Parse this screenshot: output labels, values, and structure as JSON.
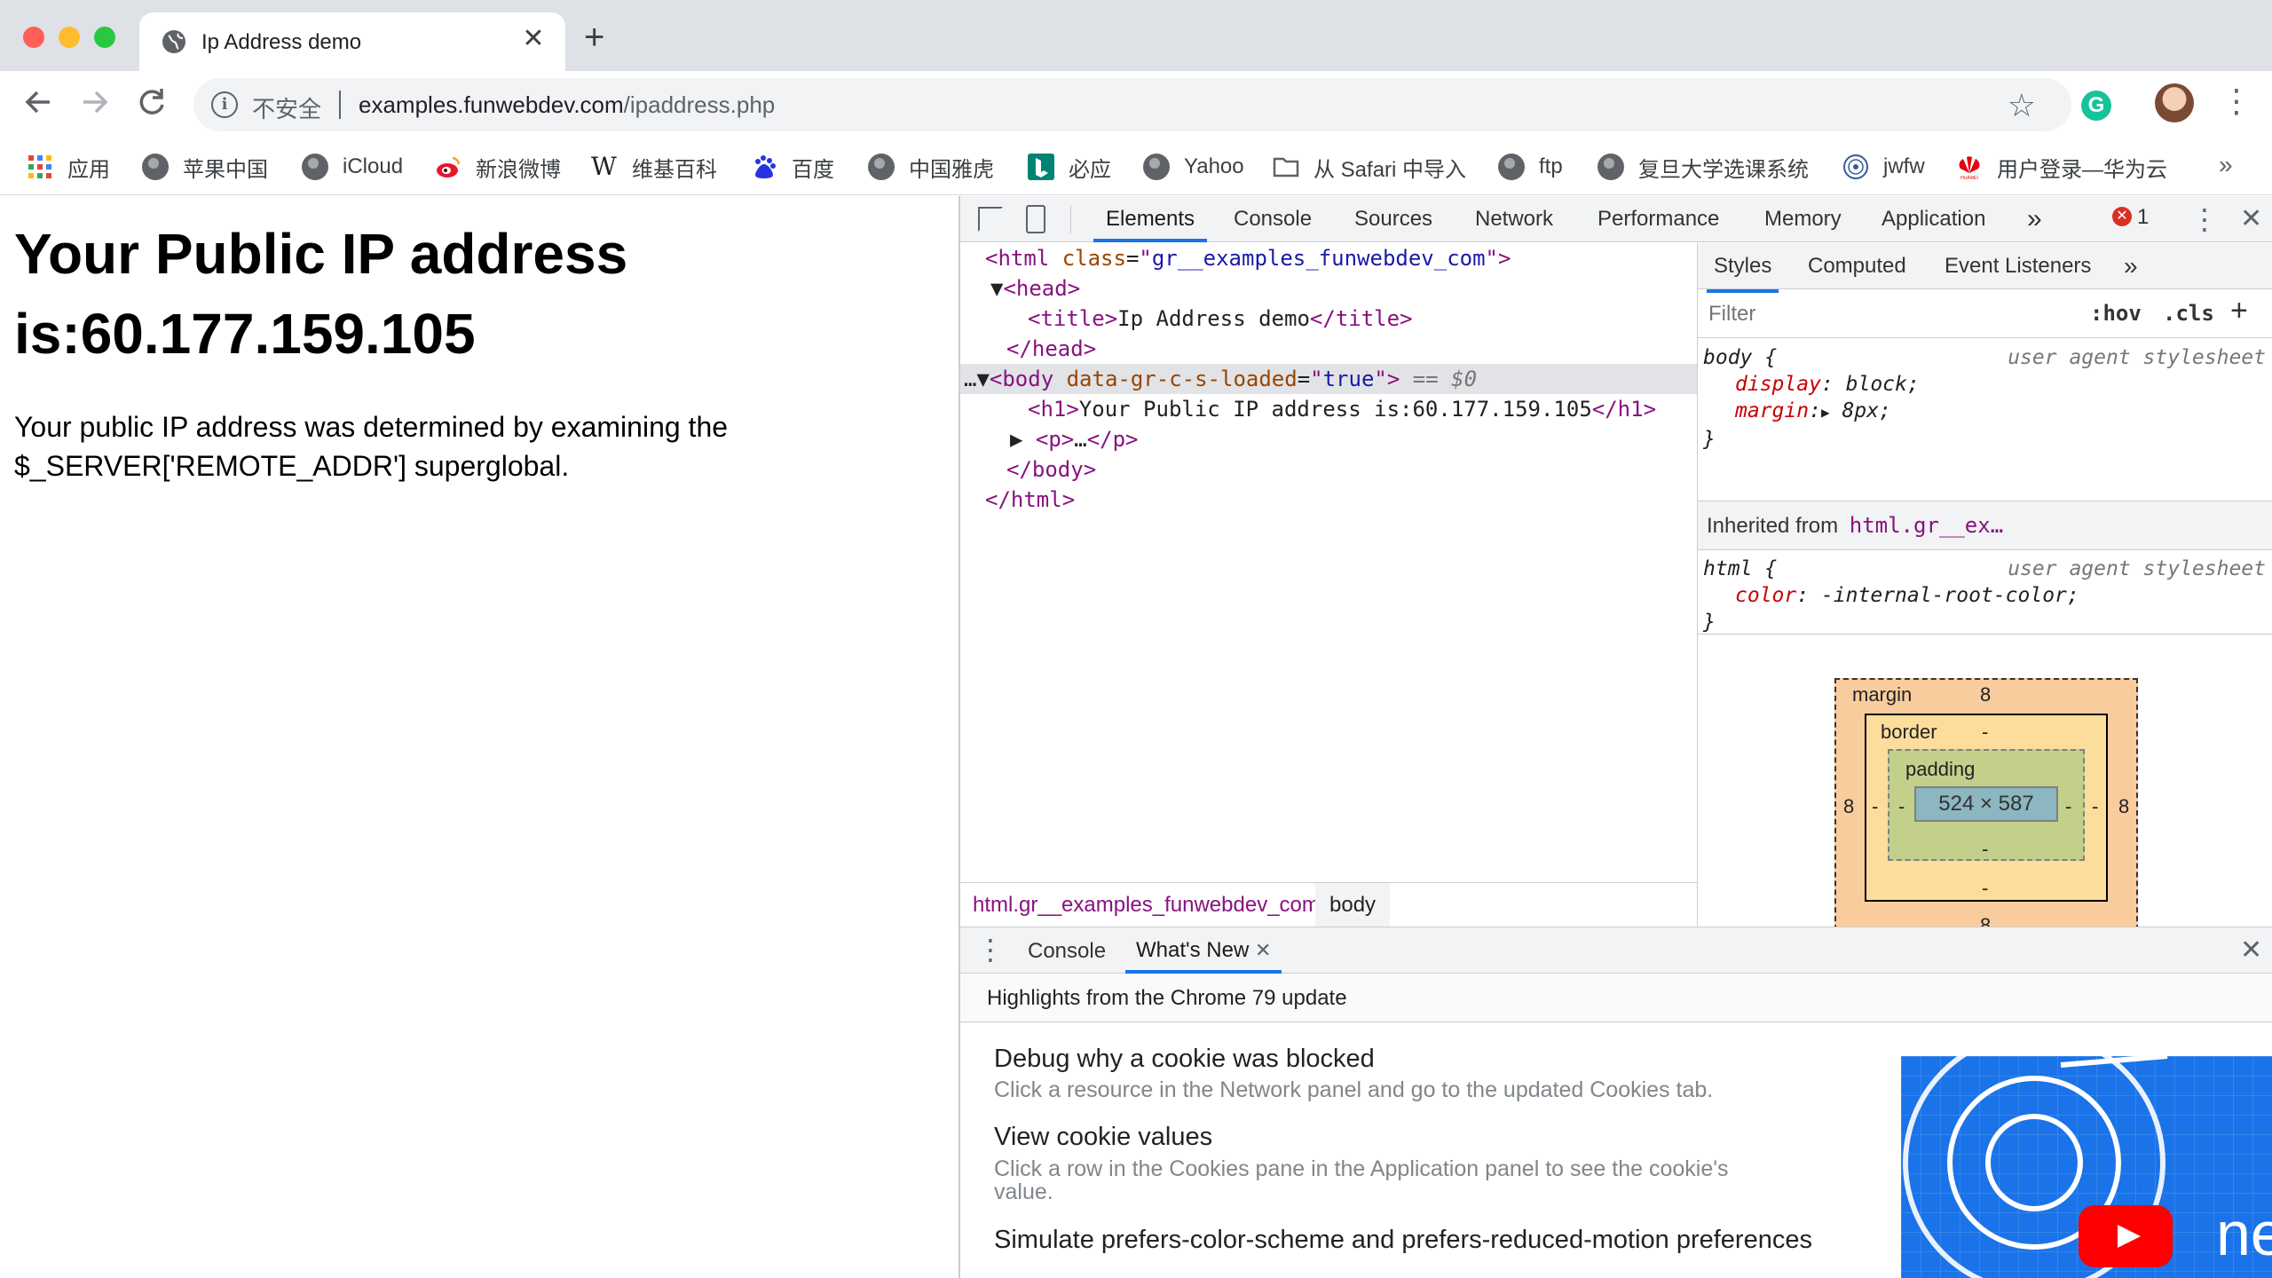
{
  "colors": {
    "tab_strip": "#dee1e6",
    "accent_blue": "#1a73e8",
    "error_red": "#d93025",
    "close_red": "#ff5f57",
    "minimize_yellow": "#febc2e",
    "zoom_green": "#28c840"
  },
  "browser": {
    "tab_title": "Ip Address demo",
    "tab_icon": "globe-icon",
    "new_tab": "+",
    "security_label": "不安全",
    "url_host": "examples.funwebdev.com",
    "url_path": "/ipaddress.php",
    "extension_letter": "G"
  },
  "bookmarks": [
    {
      "label": "应用",
      "icon": "apps-grid-icon"
    },
    {
      "label": "苹果中国",
      "icon": "globe-icon"
    },
    {
      "label": "iCloud",
      "icon": "globe-icon"
    },
    {
      "label": "新浪微博",
      "icon": "weibo-icon"
    },
    {
      "label": "维基百科",
      "icon": "wikipedia-icon"
    },
    {
      "label": "百度",
      "icon": "baidu-icon"
    },
    {
      "label": "中国雅虎",
      "icon": "globe-icon"
    },
    {
      "label": "必应",
      "icon": "bing-icon"
    },
    {
      "label": "Yahoo",
      "icon": "globe-icon"
    },
    {
      "label": "从 Safari 中导入",
      "icon": "folder-icon"
    },
    {
      "label": "ftp",
      "icon": "globe-icon"
    },
    {
      "label": "复旦大学选课系统",
      "icon": "globe-icon"
    },
    {
      "label": "jwfw",
      "icon": "fudan-seal-icon"
    },
    {
      "label": "用户登录—华为云",
      "icon": "huawei-icon"
    }
  ],
  "page": {
    "heading": "Your Public IP address is:60.177.159.105",
    "paragraph": "Your public IP address was determined by examining the $_SERVER['REMOTE_ADDR'] superglobal."
  },
  "devtools": {
    "tabs": [
      "Elements",
      "Console",
      "Sources",
      "Network",
      "Performance",
      "Memory",
      "Application"
    ],
    "active_tab": "Elements",
    "more_tabs": "»",
    "error_count": "1",
    "dom": {
      "html_open_tag": "html",
      "html_class_attr": "class",
      "html_class_value": "gr__examples_funwebdev_com",
      "head": "head",
      "title_tag": "title",
      "title_text": "Ip Address demo",
      "body_attr": "data-gr-c-s-loaded",
      "body_attr_value": "true",
      "dollar_zero": "== $0",
      "h1_text": "Your Public IP address is:60.177.159.105",
      "p_ellipsis": "…"
    },
    "breadcrumbs": [
      "html.gr__examples_funwebdev_com",
      "body"
    ],
    "styles": {
      "tabs": [
        "Styles",
        "Computed",
        "Event Listeners"
      ],
      "filter_placeholder": "Filter",
      "hov": ":hov",
      "cls": ".cls",
      "rule1_selector": "body",
      "rule1_source": "user agent stylesheet",
      "rule1_props": [
        {
          "name": "display",
          "value": "block;"
        },
        {
          "name": "margin",
          "value": "8px;"
        }
      ],
      "inherited_label": "Inherited from",
      "inherited_from": "html.gr__ex…",
      "rule2_selector": "html",
      "rule2_source": "user agent stylesheet",
      "rule2_props": [
        {
          "name": "color",
          "value": "-internal-root-color;"
        }
      ]
    },
    "box_model": {
      "margin_label": "margin",
      "margin_top": "8",
      "margin_bottom": "8",
      "margin_left": "8",
      "margin_right": "8",
      "border_label": "border",
      "border_top": "-",
      "border_bottom": "-",
      "border_left": "-",
      "border_right": "-",
      "padding_label": "padding",
      "padding_bottom": "-",
      "padding_left": "-",
      "padding_right": "-",
      "content": "524 × 587"
    },
    "drawer": {
      "tabs": [
        "Console",
        "What's New"
      ],
      "highlights": "Highlights from the Chrome 79 update",
      "items": [
        {
          "title": "Debug why a cookie was blocked",
          "desc": "Click a resource in the Network panel and go to the updated Cookies tab."
        },
        {
          "title": "View cookie values",
          "desc": "Click a row in the Cookies pane in the Application panel to see the cookie's value."
        },
        {
          "title": "Simulate prefers-color-scheme and prefers-reduced-motion preferences",
          "desc": ""
        }
      ],
      "video_text": "ne"
    }
  }
}
